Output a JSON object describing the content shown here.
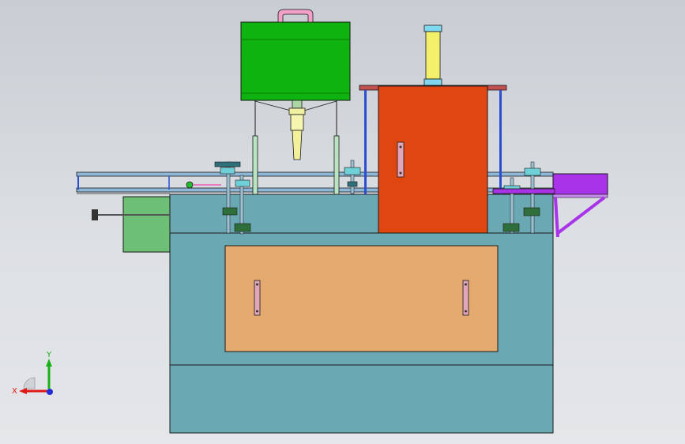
{
  "viewport": {
    "background_top": "#c8cdd3",
    "background_bottom": "#e4e6e9"
  },
  "model": {
    "parts": [
      "hopper",
      "hopper-handle",
      "dispensing-nozzle",
      "pneumatic-cylinder",
      "guard-cabinet",
      "conveyor-rail",
      "base-cabinet",
      "front-access-panel",
      "side-control-box",
      "discharge-chute"
    ],
    "colors": {
      "hopper": "#0fb30f",
      "handle": "#f2a0c8",
      "guard_cabinet": "#e0460f",
      "base_cabinet": "#6aa9b4",
      "front_panel": "#e4a96f",
      "side_box": "#6cbf74",
      "chute": "#a833e8",
      "cylinder": "#f3f06a",
      "rail": "#2a4fd0",
      "outline": "#1a1a1a"
    }
  },
  "triad": {
    "x_label": "X",
    "y_label": "Y",
    "x_color": "#e01818",
    "y_color": "#1ab01a",
    "z_color": "#1f2fd6"
  }
}
